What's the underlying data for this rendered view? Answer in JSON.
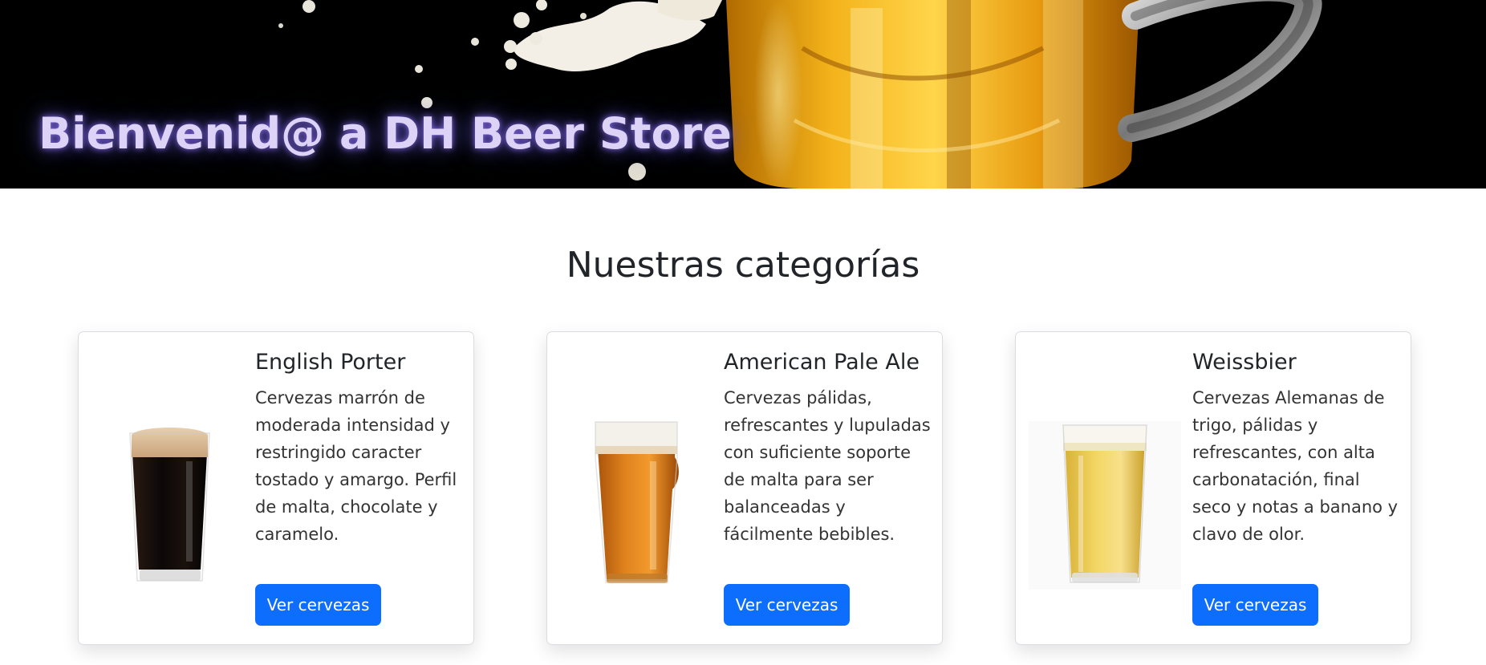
{
  "hero": {
    "title": "Bienvenid@ a DH Beer Store"
  },
  "section": {
    "title": "Nuestras categorías"
  },
  "categories": [
    {
      "name": "English Porter",
      "description": "Cervezas marrón de moderada intensidad y restringido caracter tostado y amargo. Perfil de malta, chocolate y caramelo.",
      "button_label": "Ver cervezas",
      "image": "dark-porter-pint-glass"
    },
    {
      "name": "American Pale Ale",
      "description": "Cervezas pálidas, refrescantes y lupuladas con suficiente soporte de malta para ser balanceadas y fácilmente bebibles.",
      "button_label": "Ver cervezas",
      "image": "amber-pale-ale-nonic-glass"
    },
    {
      "name": "Weissbier",
      "description": "Cervezas Alemanas de trigo, pálidas y refrescantes, con alta carbonatación, final seco y notas a banano y clavo de olor.",
      "button_label": "Ver cervezas",
      "image": "pale-wheat-beer-glass"
    }
  ],
  "colors": {
    "primary": "#0d6efd",
    "hero_background": "#000000",
    "hero_title": "#ddd3f7"
  }
}
